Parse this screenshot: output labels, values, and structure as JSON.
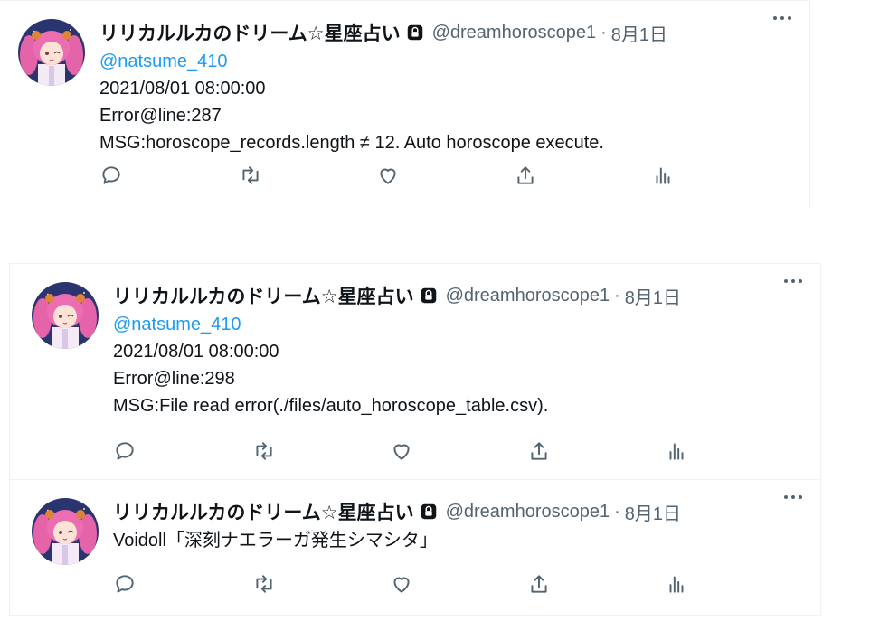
{
  "tweets": [
    {
      "name": "リリカルルカのドリーム☆星座占い",
      "handle": "@dreamhoroscope1",
      "date": "8月1日",
      "mention": "@natsume_410",
      "lines": [
        "2021/08/01 08:00:00",
        "Error@line:287",
        "MSG:horoscope_records.length ≠ 12. Auto horoscope execute."
      ]
    },
    {
      "name": "リリカルルカのドリーム☆星座占い",
      "handle": "@dreamhoroscope1",
      "date": "8月1日",
      "mention": "@natsume_410",
      "lines": [
        "2021/08/01 08:00:00",
        "Error@line:298",
        "MSG:File read error(./files/auto_horoscope_table.csv)."
      ]
    },
    {
      "name": "リリカルルカのドリーム☆星座占い",
      "handle": "@dreamhoroscope1",
      "date": "8月1日",
      "lines": [
        "Voidoll「深刻ナエラーガ発生シマシタ」"
      ]
    }
  ],
  "separator": "·",
  "icons": {
    "avatar": "anime-character-avatar",
    "lock": "lock-icon",
    "more": "more-options-icon",
    "reply": "reply-icon",
    "retweet": "retweet-icon",
    "like": "like-icon",
    "share": "share-icon",
    "analytics": "analytics-icon"
  },
  "colors": {
    "text": "#0f1419",
    "secondary": "#536471",
    "link": "#1d9bf0",
    "border": "#eff3f4"
  }
}
